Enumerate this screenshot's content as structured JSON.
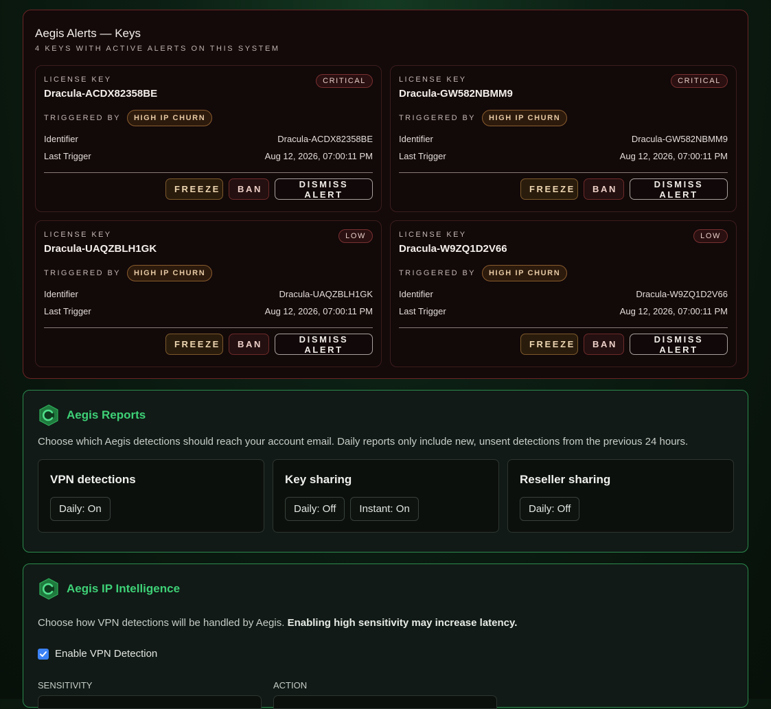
{
  "alerts": {
    "title": "Aegis Alerts — Keys",
    "subtitle": "4 KEYS WITH ACTIVE ALERTS ON THIS SYSTEM",
    "license_key_label": "LICENSE KEY",
    "triggered_by_label": "TRIGGERED BY",
    "identifier_label": "Identifier",
    "last_trigger_label": "Last Trigger",
    "freeze_label": "FREEZE",
    "ban_label": "BAN",
    "dismiss_label": "DISMISS ALERT",
    "cards": [
      {
        "key": "Dracula-ACDX82358BE",
        "severity": "CRITICAL",
        "trigger": "HIGH IP CHURN",
        "identifier": "Dracula-ACDX82358BE",
        "last_trigger": "Aug 12, 2026, 07:00:11 PM"
      },
      {
        "key": "Dracula-GW582NBMM9",
        "severity": "CRITICAL",
        "trigger": "HIGH IP CHURN",
        "identifier": "Dracula-GW582NBMM9",
        "last_trigger": "Aug 12, 2026, 07:00:11 PM"
      },
      {
        "key": "Dracula-UAQZBLH1GK",
        "severity": "LOW",
        "trigger": "HIGH IP CHURN",
        "identifier": "Dracula-UAQZBLH1GK",
        "last_trigger": "Aug 12, 2026, 07:00:11 PM"
      },
      {
        "key": "Dracula-W9ZQ1D2V66",
        "severity": "LOW",
        "trigger": "HIGH IP CHURN",
        "identifier": "Dracula-W9ZQ1D2V66",
        "last_trigger": "Aug 12, 2026, 07:00:11 PM"
      }
    ]
  },
  "reports": {
    "title": "Aegis Reports",
    "icon": "shield-icon",
    "description": "Choose which Aegis detections should reach your account email. Daily reports only include new, unsent detections from the previous 24 hours.",
    "cards": [
      {
        "title": "VPN detections",
        "pills": [
          "Daily: On"
        ]
      },
      {
        "title": "Key sharing",
        "pills": [
          "Daily: Off",
          "Instant: On"
        ]
      },
      {
        "title": "Reseller sharing",
        "pills": [
          "Daily: Off"
        ]
      }
    ]
  },
  "intel": {
    "title": "Aegis IP Intelligence",
    "icon": "shield-icon",
    "description": "Choose how VPN detections will be handled by Aegis.",
    "description_bold": "Enabling high sensitivity may increase latency.",
    "enable_vpn_label": "Enable VPN Detection",
    "enable_vpn_checked": true,
    "sensitivity_label": "SENSITIVITY",
    "action_label": "ACTION"
  },
  "colors": {
    "accent_green": "#3ed177",
    "alert_border": "#6b2424",
    "checkbox_blue": "#3b82f6"
  }
}
